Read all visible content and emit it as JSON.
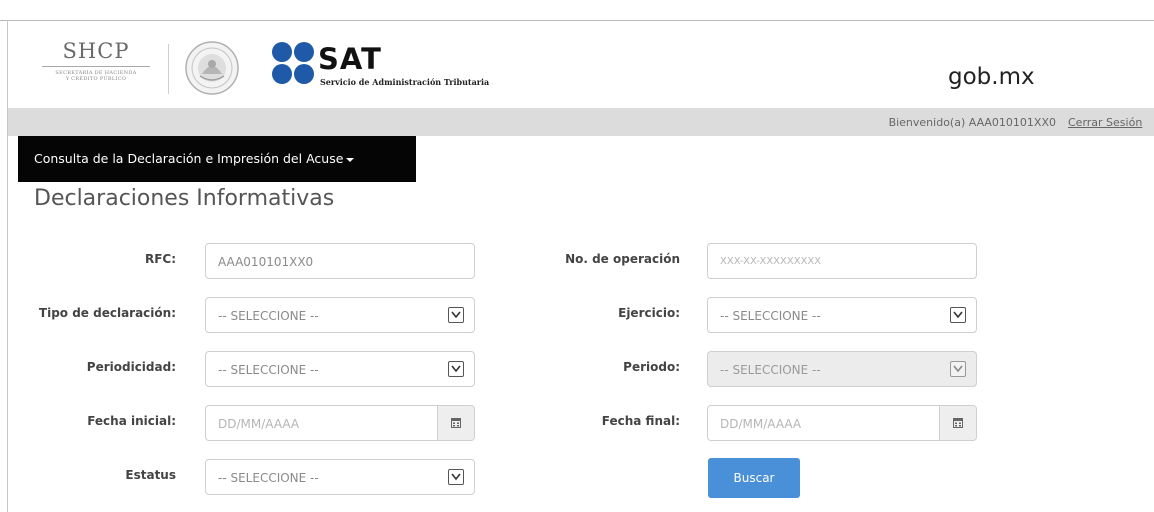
{
  "header": {
    "shcp_title": "SHCP",
    "shcp_subtitle_1": "SECRETARÍA DE HACIENDA",
    "shcp_subtitle_2": "Y CRÉDITO PÚBLICO",
    "sat_title": "SAT",
    "sat_subtitle": "Servicio de Administración Tributaria",
    "gobmx": "gob.mx"
  },
  "user_bar": {
    "welcome": "Bienvenido(a) AAA010101XX0",
    "logout": "Cerrar Sesión"
  },
  "menu": {
    "label": "Consulta de la Declaración e Impresión del Acuse"
  },
  "page_title": "Declaraciones Informativas",
  "form": {
    "rfc": {
      "label": "RFC:",
      "value": "AAA010101XX0"
    },
    "operacion": {
      "label": "No. de operación",
      "placeholder": "XXX-XX-XXXXXXXXX"
    },
    "tipo": {
      "label": "Tipo de declaración:",
      "value": "-- SELECCIONE --"
    },
    "ejercicio": {
      "label": "Ejercicio:",
      "value": "-- SELECCIONE --"
    },
    "periodicidad": {
      "label": "Periodicidad:",
      "value": "-- SELECCIONE --"
    },
    "periodo": {
      "label": "Periodo:",
      "value": "-- SELECCIONE --"
    },
    "fecha_inicial": {
      "label": "Fecha inicial:",
      "placeholder": "DD/MM/AAAA"
    },
    "fecha_final": {
      "label": "Fecha final:",
      "placeholder": "DD/MM/AAAA"
    },
    "estatus": {
      "label": "Estatus",
      "value": "-- SELECCIONE --"
    },
    "buscar": "Buscar"
  },
  "colors": {
    "menu_bg": "#050505",
    "user_bar_bg": "#dcdcdc",
    "button_bg": "#4a90d9",
    "sat_blue": "#1e5aa8"
  },
  "icons": [
    "mexican-seal-icon",
    "sat-dots-logo-icon",
    "dropdown-arrow-icon",
    "calendar-icon",
    "caret-down-icon"
  ]
}
